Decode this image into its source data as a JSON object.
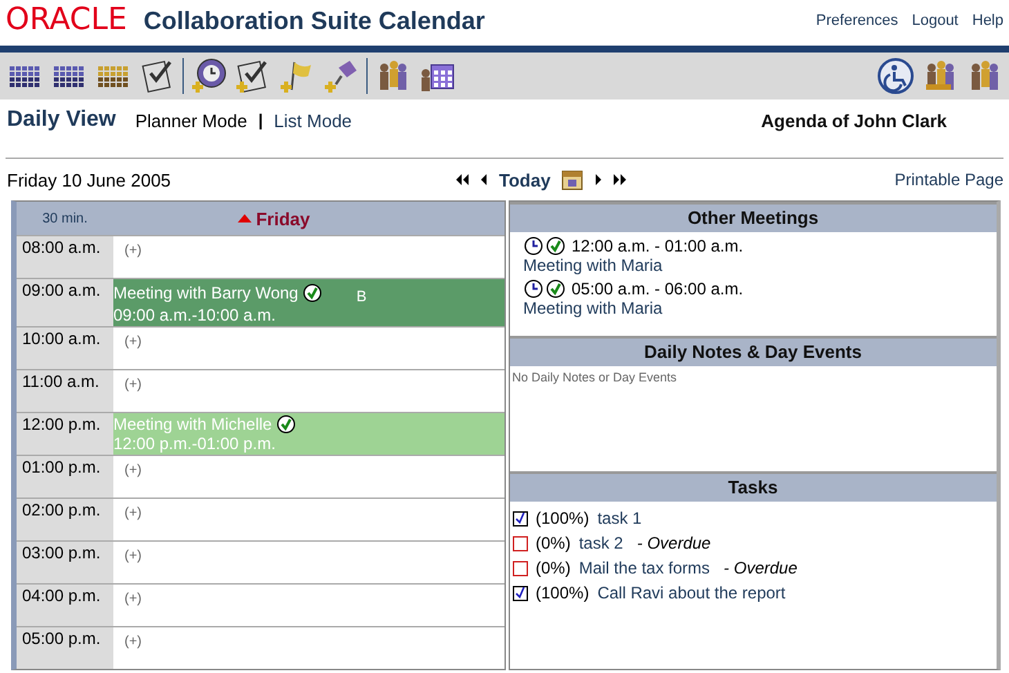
{
  "header": {
    "logo": "ORACLE",
    "title": "Collaboration Suite Calendar",
    "links": [
      "Preferences",
      "Logout",
      "Help"
    ]
  },
  "view": {
    "title": "Daily View",
    "modes": [
      {
        "label": "Planner Mode",
        "selected": true
      },
      {
        "label": "List Mode",
        "selected": false
      }
    ],
    "separator": "|",
    "agenda": "Agenda of John Clark"
  },
  "nav": {
    "date": "Friday 10 June 2005",
    "today": "Today",
    "printable": "Printable Page"
  },
  "planner": {
    "interval": "30 min.",
    "day": "Friday",
    "rows": [
      {
        "time": "08:00 a.m.",
        "kind": "empty",
        "add": "(+)"
      },
      {
        "time": "09:00 a.m.",
        "kind": "meeting",
        "title": "Meeting with Barry Wong",
        "range": "09:00 a.m.-10:00 a.m.",
        "color": "#5b9b68",
        "marker": "B"
      },
      {
        "time": "10:00 a.m.",
        "kind": "empty",
        "add": "(+)"
      },
      {
        "time": "11:00 a.m.",
        "kind": "empty",
        "add": "(+)"
      },
      {
        "time": "12:00 p.m.",
        "kind": "meeting",
        "title": "Meeting with Michelle",
        "range": "12:00 p.m.-01:00 p.m.",
        "color": "#9ed394"
      },
      {
        "time": "01:00 p.m.",
        "kind": "empty",
        "add": "(+)"
      },
      {
        "time": "02:00 p.m.",
        "kind": "empty",
        "add": "(+)"
      },
      {
        "time": "03:00 p.m.",
        "kind": "empty",
        "add": "(+)"
      },
      {
        "time": "04:00 p.m.",
        "kind": "empty",
        "add": "(+)"
      },
      {
        "time": "05:00 p.m.",
        "kind": "empty",
        "add": "(+)"
      }
    ]
  },
  "other_meetings": {
    "title": "Other Meetings",
    "items": [
      {
        "range": "12:00 a.m. - 01:00 a.m.",
        "title": "Meeting with Maria"
      },
      {
        "range": "05:00 a.m. - 06:00 a.m.",
        "title": "Meeting with Maria"
      }
    ]
  },
  "daily_notes": {
    "title": "Daily Notes & Day Events",
    "empty": "No Daily Notes or Day Events"
  },
  "tasks": {
    "title": "Tasks",
    "items": [
      {
        "checked": true,
        "percent": "(100%)",
        "name": "task 1"
      },
      {
        "checked": false,
        "percent": "(0%)",
        "name": "task 2",
        "overdue": "- Overdue"
      },
      {
        "checked": false,
        "percent": "(0%)",
        "name": "Mail the tax forms",
        "overdue": "- Overdue"
      },
      {
        "checked": true,
        "percent": "(100%)",
        "name": "Call Ravi about the report"
      }
    ]
  }
}
